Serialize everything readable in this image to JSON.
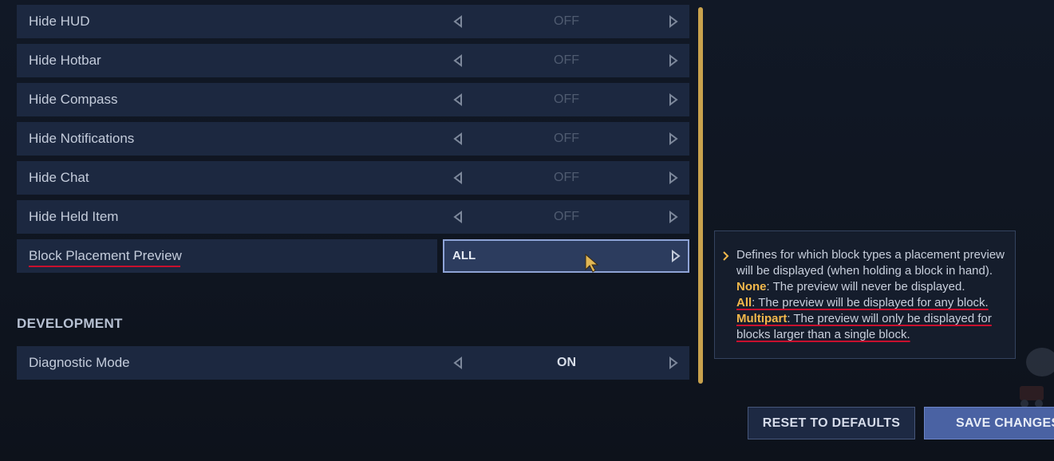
{
  "settings": {
    "rows": [
      {
        "label": "Hide HUD",
        "value": "OFF"
      },
      {
        "label": "Hide Hotbar",
        "value": "OFF"
      },
      {
        "label": "Hide Compass",
        "value": "OFF"
      },
      {
        "label": "Hide Notifications",
        "value": "OFF"
      },
      {
        "label": "Hide Chat",
        "value": "OFF"
      },
      {
        "label": "Hide Held Item",
        "value": "OFF"
      }
    ],
    "selected": {
      "label": "Block Placement Preview",
      "value": "ALL"
    }
  },
  "development": {
    "title": "DEVELOPMENT",
    "row": {
      "label": "Diagnostic Mode",
      "value": "ON"
    }
  },
  "tooltip": {
    "intro": "Defines for which block types a placement preview will be displayed (when holding a block in hand).",
    "options": [
      {
        "name": "None",
        "desc": ": The preview will never be displayed."
      },
      {
        "name": "All",
        "desc": ": The preview will be displayed for any block."
      },
      {
        "name": "Multipart",
        "desc": ": The preview will only be displayed for blocks larger than a single block."
      }
    ]
  },
  "buttons": {
    "reset": "RESET TO DEFAULTS",
    "save": "SAVE CHANGES"
  },
  "colors": {
    "row_bg": "#1c2840",
    "selected_bg": "#2c3c5e",
    "selected_border": "#8ea3d6",
    "scrollbar": "#c9a24d",
    "keyword": "#f2b84b",
    "underline": "#c8102e",
    "save_bg": "#4a62a3"
  }
}
